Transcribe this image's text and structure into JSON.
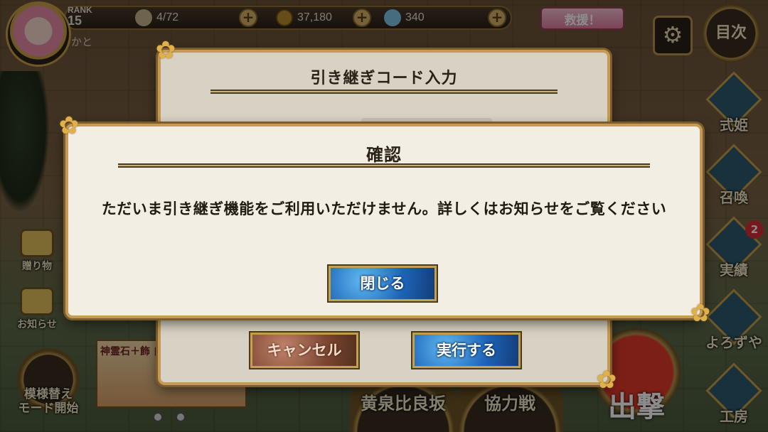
{
  "hud": {
    "rank_label": "RANK",
    "rank_value": "15",
    "player_name": "かと",
    "stamina": "4/72",
    "coins": "37,180",
    "gems": "340",
    "plus_symbol": "+",
    "rescue_label": "救援！",
    "gear_symbol": "⚙",
    "menu_label": "目次"
  },
  "side_nav": {
    "items": [
      {
        "label": "式姫"
      },
      {
        "label": "召喚"
      },
      {
        "label": "実績",
        "badge": "2"
      },
      {
        "label": "よろずや"
      },
      {
        "label": "工房"
      }
    ]
  },
  "left_nav": {
    "gift_label": "贈り物",
    "news_label": "お知らせ",
    "pattern_label": "模様替え\nモード開始"
  },
  "banner": {
    "text": "神霊石＋飾 自 飾ろうパック"
  },
  "bottom_nav": {
    "yomi": "黄泉比良坂",
    "coop": "協力戦",
    "sortie": "出撃"
  },
  "code_dialog": {
    "title": "引き継ぎコード入力",
    "cancel_label": "キャンセル",
    "execute_label": "実行する"
  },
  "confirm_dialog": {
    "title": "確認",
    "message": "ただいま引き継ぎ機能をご利用いただけません。詳しくはお知らせをご覧ください",
    "close_label": "閉じる"
  },
  "ornament": "✿",
  "colors": {
    "dialog_bg": "#f3eee3",
    "dialog_border": "#c49a54",
    "button_blue": "#1e64b8",
    "button_brown": "#7a4430"
  }
}
